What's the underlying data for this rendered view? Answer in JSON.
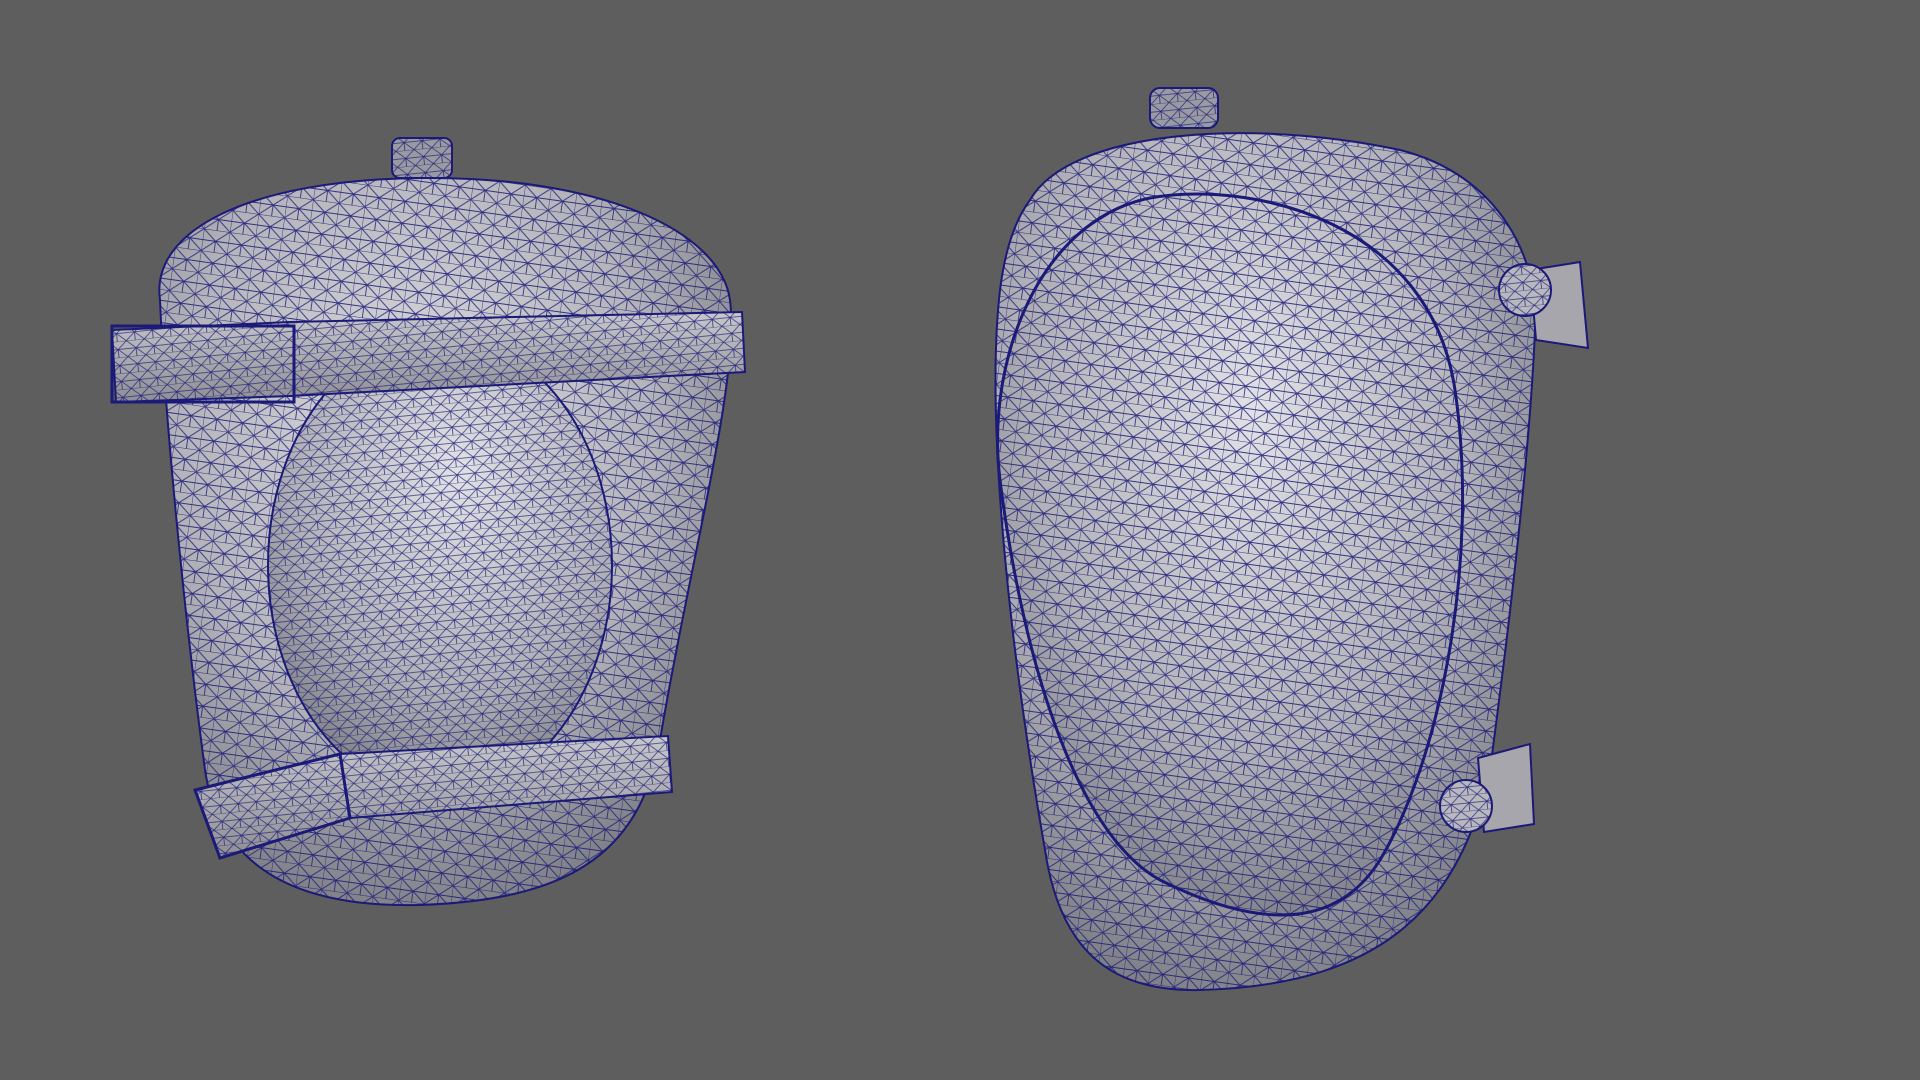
{
  "viewport": {
    "background": "#5e5e5e",
    "shading": "wireframe-on-shaded"
  },
  "colors": {
    "surface_light": "#d2d2d6",
    "surface_mid": "#a4a4aa",
    "surface_dark": "#727278",
    "wire": "#1b1a78"
  },
  "objects": [
    {
      "name": "knee-pad-inner-view",
      "parts": [
        "cushion-ring",
        "inner-pad",
        "upper-strap",
        "lower-strap",
        "top-tab"
      ]
    },
    {
      "name": "knee-pad-outer-view",
      "parts": [
        "shell",
        "cap-dome",
        "top-tab",
        "upper-buckle",
        "lower-buckle"
      ]
    }
  ]
}
